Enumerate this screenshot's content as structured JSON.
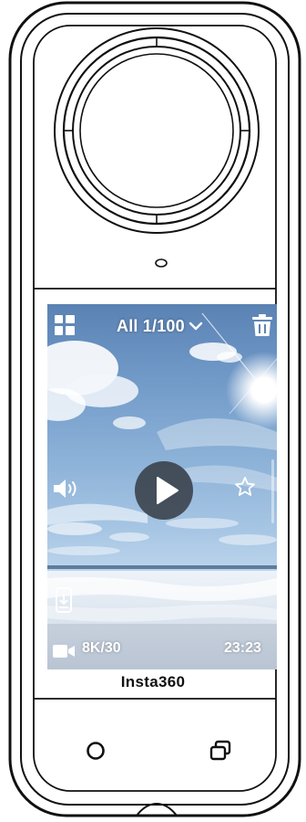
{
  "screen": {
    "album_label": "All 1/100",
    "resolution": "8K/30",
    "duration": "23:23"
  },
  "brand": "Insta360",
  "icons": {
    "gallery": "grid-icon",
    "album_dropdown": "chevron-down-icon",
    "delete": "trash-icon",
    "volume": "speaker-icon",
    "play": "play-icon",
    "favorite": "star-icon",
    "storage": "sd-card-icon",
    "camera": "video-camera-icon",
    "shutter": "circle-icon",
    "mode": "stacked-squares-icon"
  },
  "colors": {
    "outline": "#111111",
    "screen_text": "#ffffff",
    "play_button": "#32373e"
  }
}
